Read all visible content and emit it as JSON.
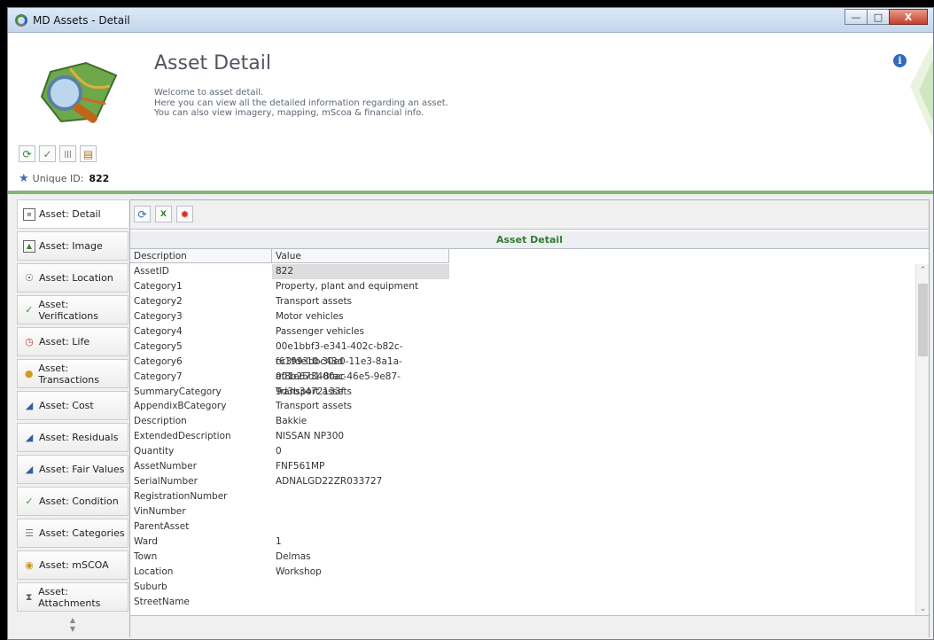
{
  "window": {
    "title": "MD Assets - Detail"
  },
  "header": {
    "title": "Asset Detail",
    "desc_lines": [
      "Welcome to asset detail.",
      "Here you can view all the detailed information regarding an asset.",
      "You can also view imagery, mapping, mScoa & financial info."
    ],
    "unique_id_label": "Unique ID:",
    "unique_id_value": "822",
    "toolbar_icons": [
      "refresh-icon",
      "check-icon",
      "barcode-icon",
      "clipboard-icon"
    ]
  },
  "sidebar": {
    "items": [
      {
        "label": "Asset: Detail",
        "icon": "detail-icon"
      },
      {
        "label": "Asset: Image",
        "icon": "image-icon"
      },
      {
        "label": "Asset: Location",
        "icon": "globe-icon"
      },
      {
        "label": "Asset: Verifications",
        "icon": "check-icon"
      },
      {
        "label": "Asset: Life",
        "icon": "clock-icon"
      },
      {
        "label": "Asset: Transactions",
        "icon": "coins-icon"
      },
      {
        "label": "Asset: Cost",
        "icon": "tag-icon"
      },
      {
        "label": "Asset: Residuals",
        "icon": "tag-icon"
      },
      {
        "label": "Asset: Fair Values",
        "icon": "tag-icon"
      },
      {
        "label": "Asset: Condition",
        "icon": "check-icon"
      },
      {
        "label": "Asset: Categories",
        "icon": "list-icon"
      },
      {
        "label": "Asset: mSCOA",
        "icon": "medal-icon"
      },
      {
        "label": "Asset: Attachments",
        "icon": "paperclip-icon"
      }
    ]
  },
  "content": {
    "toolbar_icons": [
      "refresh-icon",
      "excel-icon",
      "bug-icon"
    ],
    "grid_title": "Asset Detail",
    "columns": [
      "Description",
      "Value"
    ],
    "rows": [
      [
        "AssetID",
        "822"
      ],
      [
        "Category1",
        "Property, plant and equipment"
      ],
      [
        "Category2",
        "Transport assets"
      ],
      [
        "Category3",
        "Motor vehicles"
      ],
      [
        "Category4",
        "Passenger vehicles"
      ],
      [
        "Category5",
        "00e1bbf3-e341-402c-b82c-f61993dbc43d"
      ],
      [
        "Category6",
        "cc3fde10-30e0-11e3-8a1a-001e673400ac"
      ],
      [
        "Category7",
        "af8b25d1-8fac-46e5-9e87-9d3b3472133f"
      ],
      [
        "SummaryCategory",
        "Transport assets"
      ],
      [
        "AppendixBCategory",
        "Transport assets"
      ],
      [
        "Description",
        "Bakkie"
      ],
      [
        "ExtendedDescription",
        "NISSAN NP300"
      ],
      [
        "Quantity",
        "0"
      ],
      [
        "AssetNumber",
        "FNF561MP"
      ],
      [
        "SerialNumber",
        "ADNALGD22ZR033727"
      ],
      [
        "RegistrationNumber",
        ""
      ],
      [
        "VinNumber",
        ""
      ],
      [
        "ParentAsset",
        ""
      ],
      [
        "Ward",
        "1"
      ],
      [
        "Town",
        "Delmas"
      ],
      [
        "Location",
        "Workshop"
      ],
      [
        "Suburb",
        ""
      ],
      [
        "StreetName",
        ""
      ]
    ]
  }
}
